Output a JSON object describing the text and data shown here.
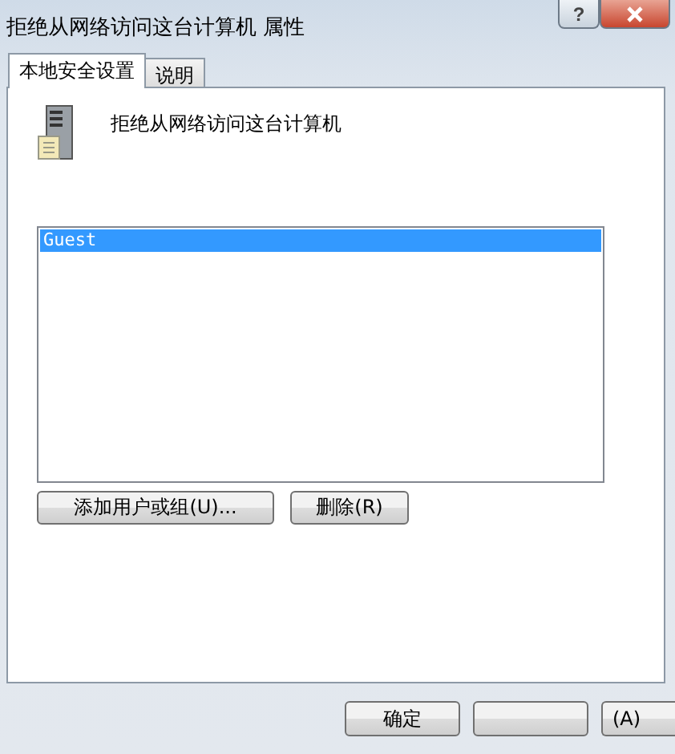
{
  "window": {
    "title": "拒绝从网络访问这台计算机 属性",
    "help_button": "?"
  },
  "tabs": [
    {
      "label": "本地安全设置",
      "selected": true
    },
    {
      "label": "说明",
      "selected": false
    }
  ],
  "policy": {
    "name": "拒绝从网络访问这台计算机"
  },
  "accounts": [
    {
      "name": "Guest",
      "selected": true
    }
  ],
  "list_buttons": [
    "添加用户或组(U)...",
    "删除(R)"
  ],
  "dialog_buttons": {
    "ok": "确定",
    "apply": "(A)"
  }
}
